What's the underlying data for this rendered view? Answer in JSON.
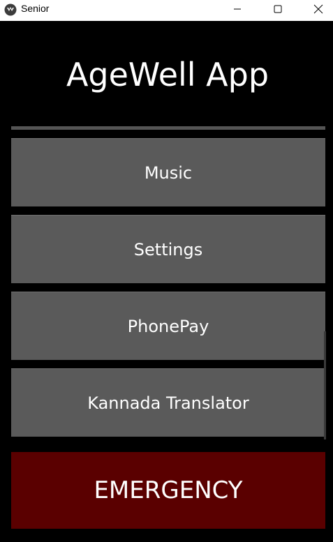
{
  "window": {
    "title": "Senior",
    "app_icon": "kivy-logo-icon",
    "controls": {
      "minimize_icon": "minimize-icon",
      "maximize_icon": "maximize-icon",
      "close_icon": "close-icon"
    }
  },
  "header": {
    "title": "AgeWell App"
  },
  "menu": {
    "items": [
      {
        "label": "Music"
      },
      {
        "label": "Settings"
      },
      {
        "label": "PhonePay"
      },
      {
        "label": "Kannada Translator"
      }
    ]
  },
  "emergency": {
    "label": "EMERGENCY",
    "color": "#5a0000"
  },
  "colors": {
    "background": "#000000",
    "button": "#5a5a5a",
    "text": "#ffffff",
    "titlebar": "#ffffff"
  }
}
